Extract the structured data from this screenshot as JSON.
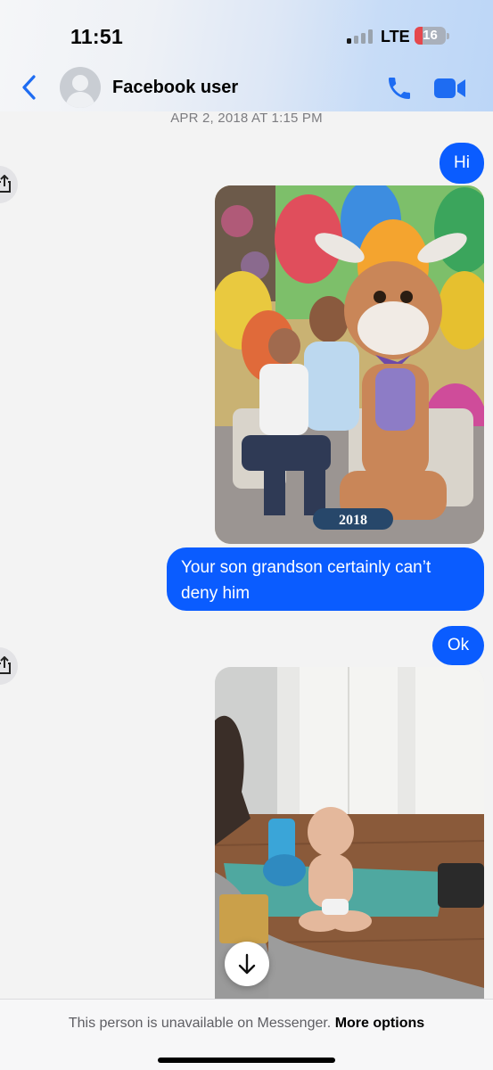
{
  "status_bar": {
    "time": "11:51",
    "network": "LTE",
    "battery": "16",
    "battery_level": 0.16
  },
  "header": {
    "contact_name": "Facebook user",
    "icons": [
      "back-chevron",
      "avatar-placeholder",
      "phone-icon",
      "video-camera-icon"
    ]
  },
  "conversation": {
    "timestamp": "APR 2, 2018 AT 1:15 PM",
    "messages": [
      {
        "type": "text",
        "text": "Hi"
      },
      {
        "type": "photo",
        "caption_in_image": "2018"
      },
      {
        "type": "text",
        "text": "Your son grandson certainly can’t deny him"
      },
      {
        "type": "text",
        "text": "Ok"
      },
      {
        "type": "photo"
      }
    ]
  },
  "footer": {
    "message": "This person is unavailable on Messenger.",
    "link": "More options"
  },
  "colors": {
    "accent": "#0a5cff",
    "battery_low": "#e5484d"
  }
}
